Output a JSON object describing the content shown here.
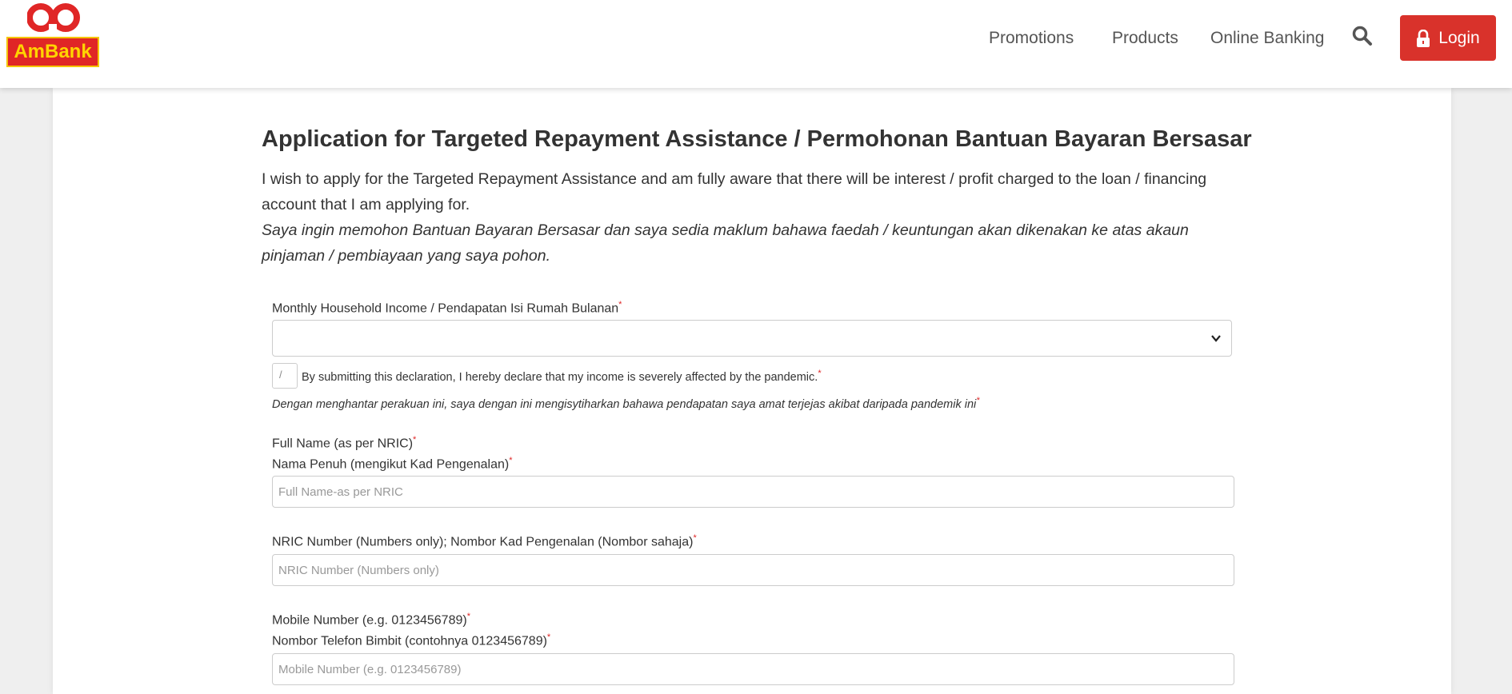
{
  "header": {
    "brand": "AmBank",
    "nav": [
      "Promotions",
      "Products",
      "Online Banking"
    ],
    "login_label": "Login"
  },
  "colors": {
    "brand_red": "#e02626",
    "brand_yellow": "#ffd400",
    "login_red": "#d9322b"
  },
  "page": {
    "title": "Application for Targeted Repayment Assistance / Permohonan Bantuan Bayaran Bersasar",
    "intro_en": "I wish to apply for the Targeted Repayment Assistance and am fully aware that there will be interest / profit charged to the loan / financing account that I am applying for.",
    "intro_ms": "Saya ingin memohon Bantuan Bayaran Bersasar dan saya sedia maklum bahawa faedah / keuntungan akan dikenakan ke atas akaun pinjaman / pembiayaan yang saya pohon."
  },
  "form": {
    "income_label": "Monthly Household Income / Pendapatan Isi Rumah Bulanan",
    "income_value": "",
    "checkbox_mark": "/",
    "declaration_en": "By submitting this declaration, I hereby declare that my income is severely affected by the pandemic.",
    "declaration_ms": "Dengan menghantar perakuan ini, saya dengan ini mengisytiharkan bahawa pendapatan saya amat terjejas akibat daripada pandemik ini",
    "name_label_en": "Full Name (as per NRIC)",
    "name_label_ms": "Nama Penuh (mengikut Kad Pengenalan)",
    "name_placeholder": "Full Name-as per NRIC",
    "nric_label": "NRIC Number (Numbers only); Nombor Kad Pengenalan (Nombor sahaja)",
    "nric_placeholder": "NRIC Number (Numbers only)",
    "mobile_label_en": "Mobile Number (e.g. 0123456789)",
    "mobile_label_ms": "Nombor Telefon Bimbit (contohnya 0123456789)",
    "mobile_placeholder": "Mobile Number (e.g. 0123456789)",
    "required_mark": "*"
  }
}
